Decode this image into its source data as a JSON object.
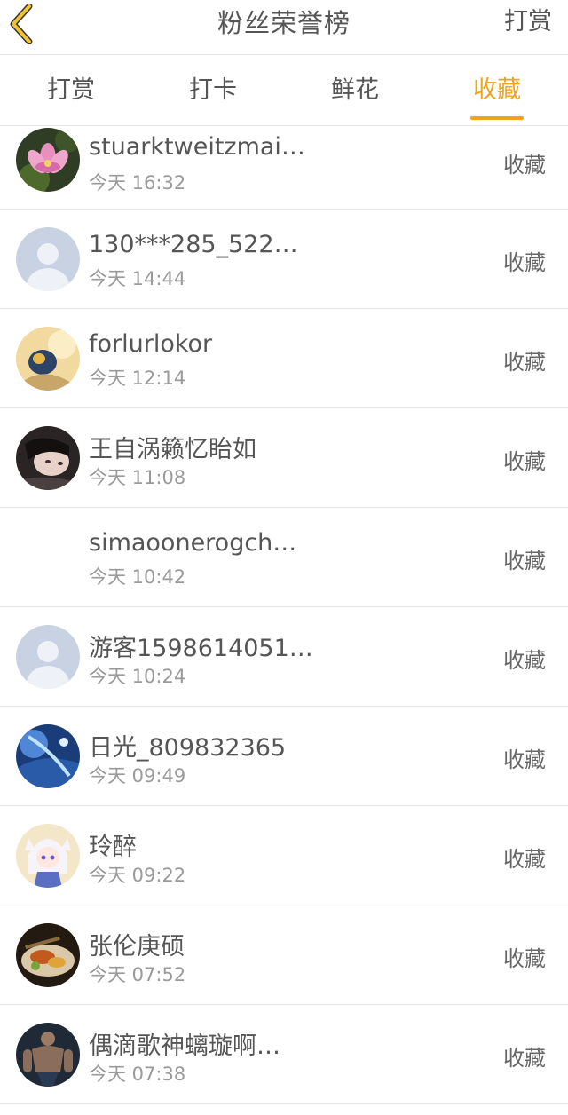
{
  "header": {
    "title": "粉丝荣誉榜",
    "action_label": "打赏",
    "accent_color": "#f1a41a"
  },
  "tabs": [
    {
      "label": "打赏",
      "active": false
    },
    {
      "label": "打卡",
      "active": false
    },
    {
      "label": "鲜花",
      "active": false
    },
    {
      "label": "收藏",
      "active": true
    }
  ],
  "list": [
    {
      "name": "stuarktweitzmai…",
      "time": "今天 16:32",
      "action": "收藏",
      "avatar": "lotus-photo"
    },
    {
      "name": "130***285_522…",
      "time": "今天 14:44",
      "action": "收藏",
      "avatar": "default-user-icon"
    },
    {
      "name": "forlurlokor",
      "time": "今天 12:14",
      "action": "收藏",
      "avatar": "painting-photo"
    },
    {
      "name": "王自涡籁忆眙如",
      "time": "今天 11:08",
      "action": "收藏",
      "avatar": "portrait-photo"
    },
    {
      "name": "simaoonerogch…",
      "time": "今天 10:42",
      "action": "收藏",
      "avatar": "blank"
    },
    {
      "name": "游客1598614051…",
      "time": "今天 10:24",
      "action": "收藏",
      "avatar": "default-user-icon"
    },
    {
      "name": "日光_809832365",
      "time": "今天 09:49",
      "action": "收藏",
      "avatar": "blue-fantasy-photo"
    },
    {
      "name": "玲醉",
      "time": "今天 09:22",
      "action": "收藏",
      "avatar": "anime-girl-photo"
    },
    {
      "name": "张伦庚硕",
      "time": "今天 07:52",
      "action": "收藏",
      "avatar": "food-photo"
    },
    {
      "name": "偶滴歌神螭璇啊…",
      "time": "今天 07:38",
      "action": "收藏",
      "avatar": "muscle-man-photo"
    }
  ]
}
